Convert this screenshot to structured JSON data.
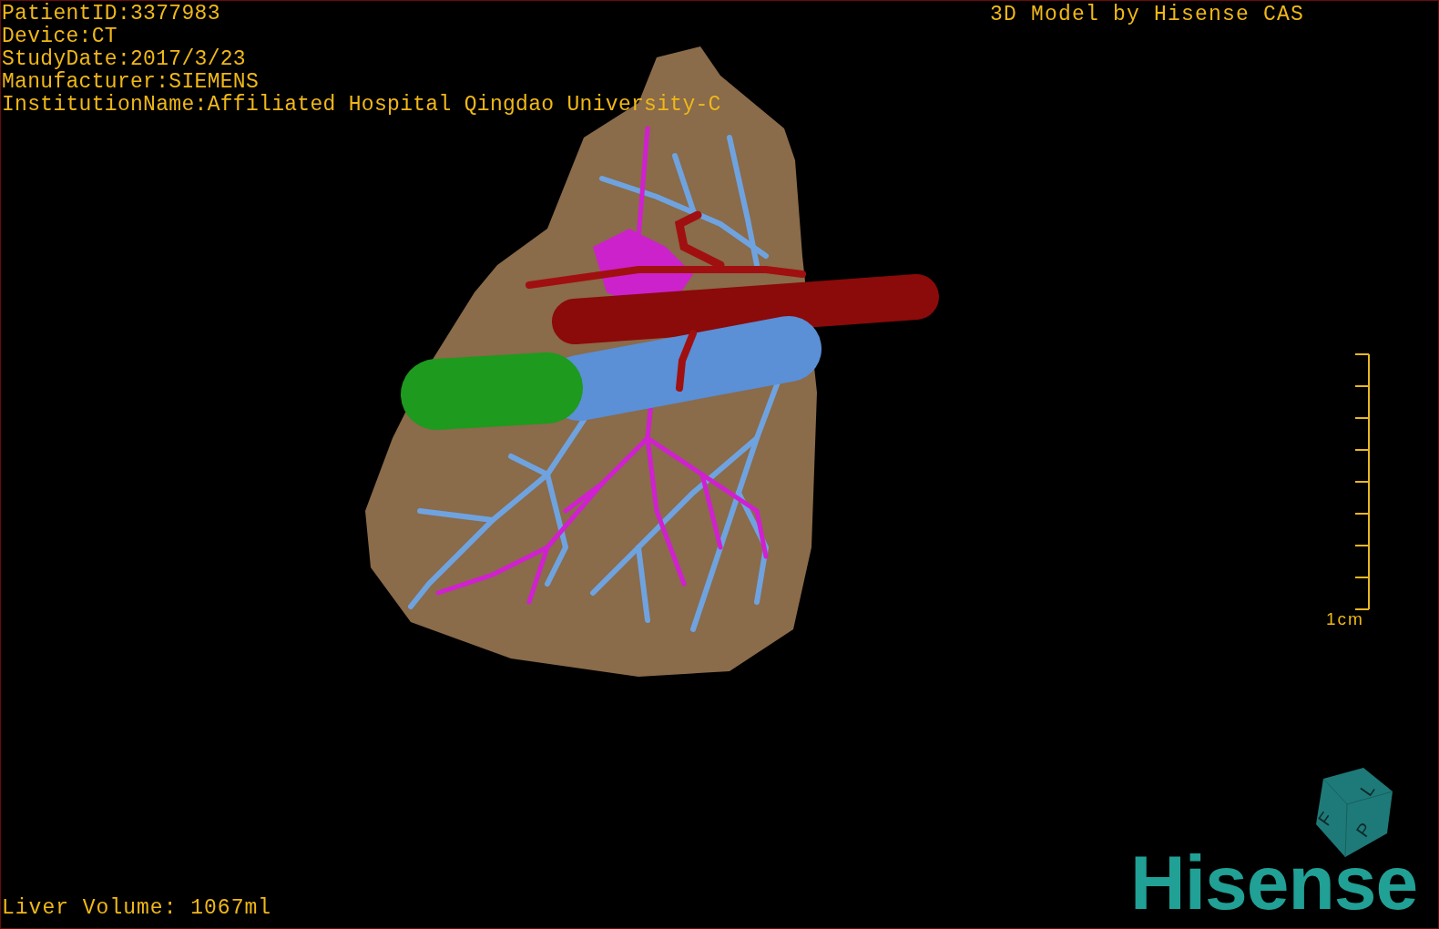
{
  "info_lines": [
    "PatientID:3377983",
    "Device:CT",
    "StudyDate:2017/3/23",
    "Manufacturer:SIEMENS",
    "InstitutionName:Affiliated Hospital Qingdao University-C"
  ],
  "credit": "3D Model by Hisense CAS",
  "scale_bar": {
    "label": "1cm"
  },
  "orientation_cube": {
    "faces": [
      "F",
      "L",
      "P"
    ]
  },
  "logo": "Hisense",
  "footer": "Liver Volume: 1067ml"
}
